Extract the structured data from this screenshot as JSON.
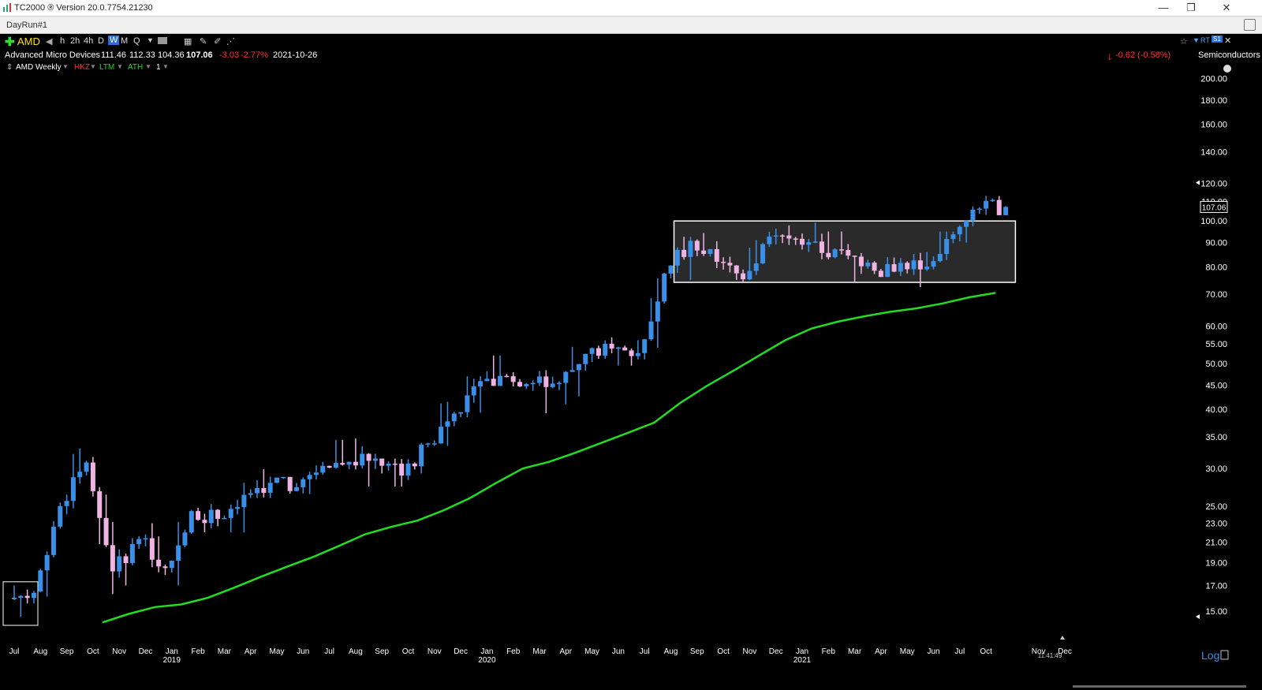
{
  "app": {
    "title": "TC2000 ® Version 20.0.7754.21230",
    "document_tab": "DayRun#1"
  },
  "toolbar": {
    "symbol": "AMD",
    "timeframes": [
      "h",
      "2h",
      "4h",
      "D",
      "W",
      "M",
      "Q"
    ],
    "active_timeframe": "W"
  },
  "quote": {
    "company": "Advanced Micro Devices",
    "open": "111.46",
    "high": "112.33",
    "low": "104.36",
    "close": "107.06",
    "change": "-3.03",
    "change_pct": "-2.77%",
    "date": "2021-10-26",
    "after_change": "-0.62",
    "after_pct": "(-0.58%)",
    "industry": "Semiconductors"
  },
  "studies": {
    "chart_label": "AMD Weekly",
    "items": [
      {
        "label": "HKZ",
        "color": "#ff2d2d"
      },
      {
        "label": "LTM",
        "color": "#22dd22"
      },
      {
        "label": "ATH",
        "color": "#22dd22"
      }
    ],
    "count": "1"
  },
  "status": {
    "time": "11:41:49",
    "scale_button": "Log"
  },
  "colors": {
    "background": "#000000",
    "up_candle": "#3a8fe8",
    "down_candle": "#f0b4e4",
    "moving_average": "#22dd22",
    "consolidation_box": "#ffffff"
  },
  "chart_data": {
    "type": "candlestick",
    "title": "AMD Weekly",
    "y_scale": "log",
    "y_ticks": [
      "15.00",
      "17.00",
      "19.00",
      "21.00",
      "23.00",
      "25.00",
      "30.00",
      "35.00",
      "40.00",
      "45.00",
      "50.00",
      "55.00",
      "60.00",
      "70.00",
      "80.00",
      "90.00",
      "100.00",
      "110.00",
      "120.00",
      "140.00",
      "160.00",
      "180.00",
      "200.00"
    ],
    "y_tick_values": [
      15,
      17,
      19,
      21,
      23,
      25,
      30,
      35,
      40,
      45,
      50,
      55,
      60,
      70,
      80,
      90,
      100,
      110,
      120,
      140,
      160,
      180,
      200
    ],
    "ylim": [
      14,
      205
    ],
    "last_price_label": "107.06",
    "x_labels": [
      "Jul",
      "Aug",
      "Sep",
      "Oct",
      "Nov",
      "Dec",
      "Jan",
      "Feb",
      "Mar",
      "Apr",
      "May",
      "Jun",
      "Jul",
      "Aug",
      "Sep",
      "Oct",
      "Nov",
      "Dec",
      "Jan",
      "Feb",
      "Mar",
      "Apr",
      "May",
      "Jun",
      "Jul",
      "Aug",
      "Sep",
      "Oct",
      "Nov",
      "Dec",
      "Jan",
      "Feb",
      "Mar",
      "Apr",
      "May",
      "Jun",
      "Jul",
      "Oct",
      "Nov",
      "Dec"
    ],
    "year_labels": [
      "2019",
      "2020",
      "2021"
    ],
    "monthly_bars": [
      {
        "m": "2018-07",
        "o": 15.9,
        "h": 17.0,
        "l": 14.6,
        "c": 16.4
      },
      {
        "m": "2018-08",
        "o": 16.5,
        "h": 26.0,
        "l": 16.0,
        "c": 25.0
      },
      {
        "m": "2018-09",
        "o": 25.0,
        "h": 34.1,
        "l": 24.0,
        "c": 30.9
      },
      {
        "m": "2018-10",
        "o": 30.9,
        "h": 33.0,
        "l": 16.3,
        "c": 18.2
      },
      {
        "m": "2018-11",
        "o": 18.2,
        "h": 23.7,
        "l": 17.0,
        "c": 21.3
      },
      {
        "m": "2018-12",
        "o": 21.3,
        "h": 23.0,
        "l": 16.0,
        "c": 18.5
      },
      {
        "m": "2019-01",
        "o": 18.5,
        "h": 25.0,
        "l": 17.0,
        "c": 24.4
      },
      {
        "m": "2019-02",
        "o": 24.4,
        "h": 25.5,
        "l": 22.0,
        "c": 23.5
      },
      {
        "m": "2019-03",
        "o": 23.5,
        "h": 28.0,
        "l": 22.0,
        "c": 26.4
      },
      {
        "m": "2019-04",
        "o": 26.4,
        "h": 29.9,
        "l": 26.0,
        "c": 28.0
      },
      {
        "m": "2019-05",
        "o": 28.0,
        "h": 28.5,
        "l": 25.5,
        "c": 27.4
      },
      {
        "m": "2019-06",
        "o": 27.4,
        "h": 33.0,
        "l": 26.5,
        "c": 30.4
      },
      {
        "m": "2019-07",
        "o": 30.4,
        "h": 34.5,
        "l": 29.5,
        "c": 31.0
      },
      {
        "m": "2019-08",
        "o": 31.0,
        "h": 35.5,
        "l": 27.5,
        "c": 31.5
      },
      {
        "m": "2019-09",
        "o": 31.5,
        "h": 31.5,
        "l": 27.5,
        "c": 29.0
      },
      {
        "m": "2019-10",
        "o": 29.0,
        "h": 34.0,
        "l": 27.5,
        "c": 33.9
      },
      {
        "m": "2019-11",
        "o": 33.9,
        "h": 41.5,
        "l": 33.5,
        "c": 39.2
      },
      {
        "m": "2019-12",
        "o": 39.2,
        "h": 47.0,
        "l": 38.5,
        "c": 45.9
      },
      {
        "m": "2020-01",
        "o": 45.9,
        "h": 52.0,
        "l": 45.0,
        "c": 47.0
      },
      {
        "m": "2020-02",
        "o": 47.0,
        "h": 59.0,
        "l": 43.0,
        "c": 45.5
      },
      {
        "m": "2020-03",
        "o": 45.5,
        "h": 52.0,
        "l": 36.8,
        "c": 45.5
      },
      {
        "m": "2020-04",
        "o": 45.5,
        "h": 57.5,
        "l": 41.0,
        "c": 52.4
      },
      {
        "m": "2020-05",
        "o": 52.4,
        "h": 57.0,
        "l": 49.5,
        "c": 53.8
      },
      {
        "m": "2020-06",
        "o": 53.8,
        "h": 56.0,
        "l": 49.5,
        "c": 52.6
      },
      {
        "m": "2020-07",
        "o": 52.6,
        "h": 78.0,
        "l": 50.0,
        "c": 77.4
      },
      {
        "m": "2020-08",
        "o": 77.4,
        "h": 92.6,
        "l": 75.0,
        "c": 90.8
      },
      {
        "m": "2020-09",
        "o": 90.8,
        "h": 94.3,
        "l": 74.0,
        "c": 82.0
      },
      {
        "m": "2020-10",
        "o": 82.0,
        "h": 94.3,
        "l": 74.2,
        "c": 75.3
      },
      {
        "m": "2020-11",
        "o": 75.3,
        "h": 95.0,
        "l": 75.0,
        "c": 92.7
      },
      {
        "m": "2020-12",
        "o": 92.7,
        "h": 97.9,
        "l": 89.0,
        "c": 91.7
      },
      {
        "m": "2021-01",
        "o": 91.7,
        "h": 99.2,
        "l": 83.0,
        "c": 85.6
      },
      {
        "m": "2021-02",
        "o": 85.6,
        "h": 95.0,
        "l": 83.0,
        "c": 84.5
      },
      {
        "m": "2021-03",
        "o": 84.5,
        "h": 88.0,
        "l": 72.5,
        "c": 78.5
      },
      {
        "m": "2021-04",
        "o": 78.5,
        "h": 88.0,
        "l": 76.5,
        "c": 81.6
      },
      {
        "m": "2021-05",
        "o": 81.6,
        "h": 86.0,
        "l": 72.5,
        "c": 80.1
      },
      {
        "m": "2021-06",
        "o": 80.1,
        "h": 95.0,
        "l": 76.5,
        "c": 93.7
      },
      {
        "m": "2021-07",
        "o": 93.7,
        "h": 122.5,
        "l": 90.0,
        "c": 106.2
      },
      {
        "m": "2021-08",
        "o": 106.2,
        "h": 113.0,
        "l": 103.0,
        "c": 107.06
      }
    ],
    "ma_points": [
      {
        "m": "2018-10",
        "v": 14.2
      },
      {
        "m": "2018-11",
        "v": 14.8
      },
      {
        "m": "2018-12",
        "v": 15.3
      },
      {
        "m": "2019-01",
        "v": 15.5
      },
      {
        "m": "2019-02",
        "v": 16.0
      },
      {
        "m": "2019-03",
        "v": 16.8
      },
      {
        "m": "2019-04",
        "v": 17.7
      },
      {
        "m": "2019-05",
        "v": 18.6
      },
      {
        "m": "2019-06",
        "v": 19.5
      },
      {
        "m": "2019-07",
        "v": 20.6
      },
      {
        "m": "2019-08",
        "v": 21.8
      },
      {
        "m": "2019-09",
        "v": 22.6
      },
      {
        "m": "2019-10",
        "v": 23.3
      },
      {
        "m": "2019-11",
        "v": 24.5
      },
      {
        "m": "2019-12",
        "v": 26.0
      },
      {
        "m": "2020-01",
        "v": 28.0
      },
      {
        "m": "2020-02",
        "v": 30.0
      },
      {
        "m": "2020-03",
        "v": 31.0
      },
      {
        "m": "2020-04",
        "v": 32.4
      },
      {
        "m": "2020-05",
        "v": 34.0
      },
      {
        "m": "2020-06",
        "v": 35.7
      },
      {
        "m": "2020-07",
        "v": 37.5
      },
      {
        "m": "2020-08",
        "v": 41.3
      },
      {
        "m": "2020-09",
        "v": 44.8
      },
      {
        "m": "2020-10",
        "v": 48.2
      },
      {
        "m": "2020-11",
        "v": 52.0
      },
      {
        "m": "2020-12",
        "v": 56.0
      },
      {
        "m": "2021-01",
        "v": 59.3
      },
      {
        "m": "2021-02",
        "v": 61.3
      },
      {
        "m": "2021-03",
        "v": 62.9
      },
      {
        "m": "2021-04",
        "v": 64.3
      },
      {
        "m": "2021-05",
        "v": 65.4
      },
      {
        "m": "2021-06",
        "v": 67.0
      },
      {
        "m": "2021-07",
        "v": 69.0
      },
      {
        "m": "2021-08",
        "v": 70.5
      }
    ],
    "consolidation_box": {
      "from": "2020-08",
      "to": "2021-09",
      "low": 74.2,
      "high": 100.0
    }
  }
}
